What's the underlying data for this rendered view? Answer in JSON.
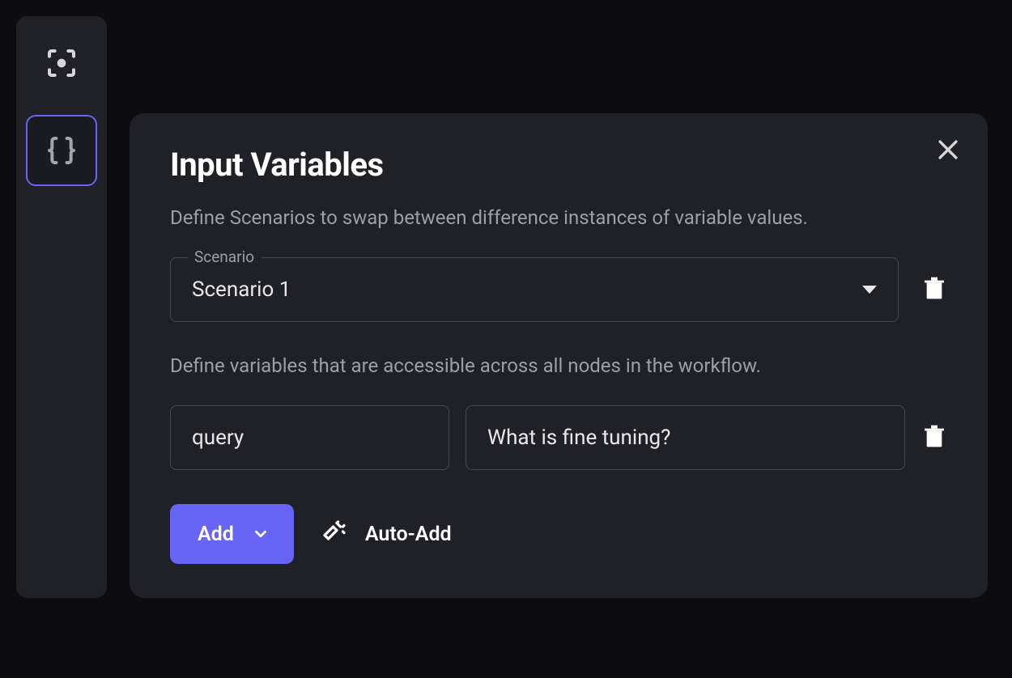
{
  "sidebar": {
    "items": [
      {
        "name": "focus-icon",
        "active": false
      },
      {
        "name": "braces-icon",
        "active": true
      }
    ]
  },
  "panel": {
    "title": "Input Variables",
    "scenario_description": "Define Scenarios to swap between difference instances of variable values.",
    "scenario_label": "Scenario",
    "scenario_selected": "Scenario 1",
    "variables_description": "Define variables that are accessible across all nodes in the workflow.",
    "variables": [
      {
        "name": "query",
        "value": "What is fine tuning?"
      }
    ],
    "add_label": "Add",
    "auto_add_label": "Auto-Add"
  }
}
